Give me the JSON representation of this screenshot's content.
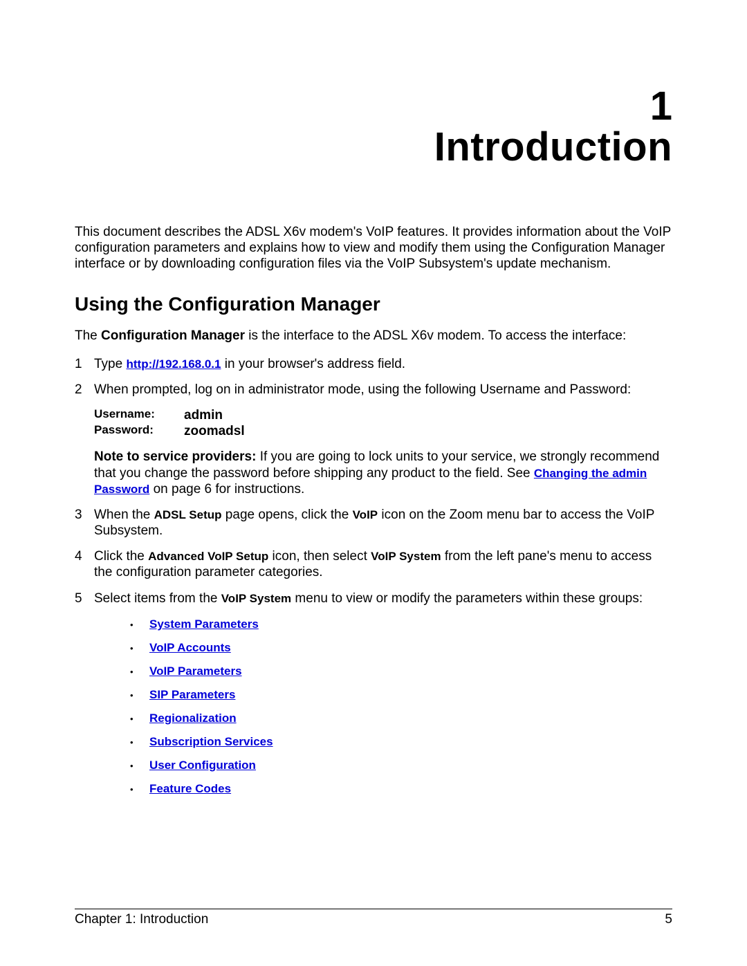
{
  "chapter": {
    "number": "1",
    "title": "Introduction"
  },
  "intro": "This document describes the ADSL X6v modem's VoIP features. It provides information about the VoIP configuration parameters and explains how to view and modify them using the Configuration Manager interface or by downloading configuration files via the VoIP Subsystem's update mechanism.",
  "section": {
    "heading": "Using the Configuration Manager",
    "intro_pre": "The ",
    "intro_bold": "Configuration Manager",
    "intro_post": " is the interface to the ADSL X6v modem. To access the interface:"
  },
  "steps": {
    "s1": {
      "num": "1",
      "pre": "Type ",
      "link": "http://192.168.0.1",
      "post": " in your browser's address field."
    },
    "s2": {
      "num": "2",
      "text": "When prompted, log on in administrator mode, using the following Username and Password:",
      "cred": {
        "user_label": "Username:",
        "user_value": "admin",
        "pass_label": "Password:",
        "pass_value": "zoomadsl"
      },
      "note": {
        "bold": "Note to service providers:",
        "mid1": " If you are going to lock units to your service, we strongly recommend that you change the password before shipping any product to the field. See ",
        "link": "Changing the admin Password",
        "mid2": " on page 6 for instructions."
      }
    },
    "s3": {
      "num": "3",
      "p1": "When the ",
      "b1": "ADSL Setup",
      "p2": " page opens, click the ",
      "b2": "VoIP",
      "p3": " icon on the Zoom menu bar to access the VoIP Subsystem."
    },
    "s4": {
      "num": "4",
      "p1": "Click the ",
      "b1": "Advanced VoIP Setup",
      "p2": " icon, then select ",
      "b2": "VoIP System",
      "p3": " from the left pane's menu to access the configuration parameter categories."
    },
    "s5": {
      "num": "5",
      "p1": "Select items from the ",
      "b1": "VoIP System",
      "p2": " menu to view or modify the parameters within these groups:",
      "bullets": {
        "i0": "System Parameters",
        "i1": "VoIP Accounts",
        "i2": "VoIP Parameters",
        "i3": "SIP Parameters",
        "i4": "Regionalization",
        "i5": "Subscription Services",
        "i6": "User Configuration",
        "i7": "Feature Codes"
      }
    }
  },
  "footer": {
    "left": "Chapter 1: Introduction",
    "right": "5"
  }
}
